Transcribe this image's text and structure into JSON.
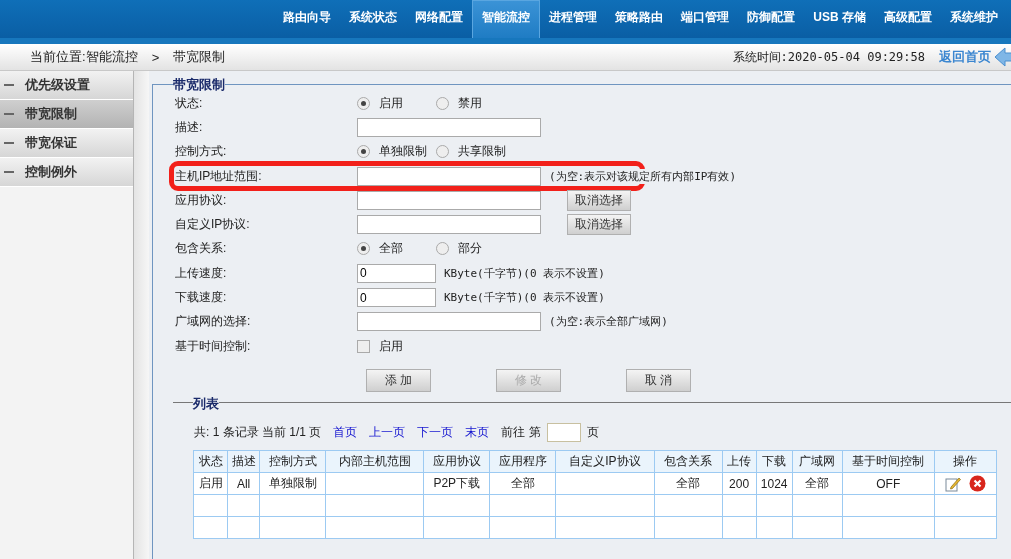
{
  "nav": [
    {
      "label": "路由向导",
      "selected": false
    },
    {
      "label": "系统状态",
      "selected": false
    },
    {
      "label": "网络配置",
      "selected": false
    },
    {
      "label": "智能流控",
      "selected": true
    },
    {
      "label": "进程管理",
      "selected": false
    },
    {
      "label": "策略路由",
      "selected": false
    },
    {
      "label": "端口管理",
      "selected": false
    },
    {
      "label": "防御配置",
      "selected": false
    },
    {
      "label": "USB 存储",
      "selected": false
    },
    {
      "label": "高级配置",
      "selected": false
    },
    {
      "label": "系统维护",
      "selected": false
    }
  ],
  "breadcrumb": {
    "location": "当前位置:智能流控",
    "separator": ">",
    "current": "带宽限制",
    "system_time": "系统时间:2020-05-04 09:29:58",
    "home_link": "返回首页"
  },
  "sidebar": {
    "items": [
      {
        "label": "优先级设置",
        "selected": false
      },
      {
        "label": "带宽限制",
        "selected": true
      },
      {
        "label": "带宽保证",
        "selected": false
      },
      {
        "label": "控制例外",
        "selected": false
      }
    ]
  },
  "form": {
    "legend": "带宽限制",
    "rows": [
      {
        "kind": "radio",
        "label": "状态:",
        "options": [
          {
            "label": "启用",
            "selected": true
          },
          {
            "label": "禁用",
            "selected": false
          }
        ]
      },
      {
        "kind": "input",
        "label": "描述:"
      },
      {
        "kind": "radio",
        "label": "控制方式:",
        "options": [
          {
            "label": "单独限制",
            "selected": true
          },
          {
            "label": "共享限制",
            "selected": false
          }
        ]
      },
      {
        "kind": "input",
        "label": "主机IP地址范围:",
        "hint": "(为空:表示对该规定所有内部IP有效)",
        "highlighted": true
      },
      {
        "kind": "input",
        "label": "应用协议:",
        "button": "取消选择"
      },
      {
        "kind": "input",
        "label": "自定义IP协议:",
        "button": "取消选择"
      },
      {
        "kind": "radio",
        "label": "包含关系:",
        "options": [
          {
            "label": "全部",
            "selected": true
          },
          {
            "label": "部分",
            "selected": false
          }
        ]
      },
      {
        "kind": "short-input",
        "label": "上传速度:",
        "value": "0",
        "hint": "KByte(千字节)(0 表示不设置)"
      },
      {
        "kind": "short-input",
        "label": "下载速度:",
        "value": "0",
        "hint": "KByte(千字节)(0 表示不设置)"
      },
      {
        "kind": "input",
        "label": "广域网的选择:",
        "hint": "(为空:表示全部广域网)"
      },
      {
        "kind": "checkbox",
        "label": "基于时间控制:",
        "option": {
          "label": "启用",
          "checked": false
        }
      }
    ],
    "buttons": [
      {
        "label": "添 加",
        "disabled": false
      },
      {
        "label": "修 改",
        "disabled": true
      },
      {
        "label": "取 消",
        "disabled": false
      }
    ]
  },
  "list": {
    "legend": "列表",
    "pager": {
      "summary": "共: 1 条记录 当前 1/1 页",
      "links": [
        "首页",
        "上一页",
        "下一页",
        "末页"
      ],
      "goto_prefix": "前往 第",
      "goto_suffix": "页"
    },
    "columns": [
      "状态",
      "描述",
      "控制方式",
      "内部主机范围",
      "应用协议",
      "应用程序",
      "自定义IP协议",
      "包含关系",
      "上传",
      "下载",
      "广域网",
      "基于时间控制",
      "操作"
    ],
    "rows": [
      {
        "cells": [
          "启用",
          "All",
          "单独限制",
          "",
          "P2P下载",
          "全部",
          "",
          "全部",
          "200",
          "1024",
          "全部",
          "OFF"
        ],
        "actions": true
      }
    ]
  }
}
